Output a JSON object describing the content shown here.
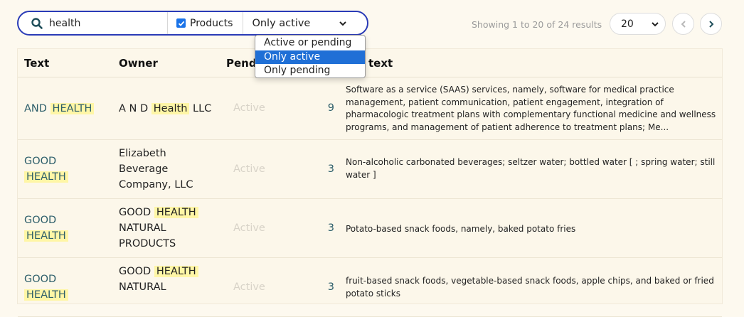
{
  "search": {
    "value": "health",
    "products_label": "Products",
    "products_checked": true,
    "status_selected": "Only active",
    "status_options": [
      "Active or pending",
      "Only active",
      "Only pending"
    ]
  },
  "results_text": "Showing 1 to 20 of 24 results",
  "page_size": "20",
  "table": {
    "headers": [
      "Text",
      "Owner",
      "Pend",
      "text"
    ],
    "rows": [
      {
        "text_pre": "AND",
        "text_hl": "HEALTH",
        "owner_pre": "A N D",
        "owner_hl": "Health",
        "owner_post": "LLC",
        "status": "Active",
        "count": "9",
        "context": "Software as a service (SAAS) services, namely, software for medical practice management, patient communication, patient engagement, integration of pharmacologic treatment plans with complementary functional medicine and wellness programs, and management of patient adherence to treatment plans; Me..."
      },
      {
        "text_pre": "GOOD",
        "text_hl": "HEALTH",
        "owner_full": "Elizabeth Beverage Company, LLC",
        "status": "Active",
        "count": "3",
        "context": "Non-alcoholic carbonated beverages; seltzer water; bottled water [ ; spring water; still water ]"
      },
      {
        "text_pre": "GOOD",
        "text_hl": "HEALTH",
        "owner_pre": "GOOD",
        "owner_hl": "HEALTH",
        "owner_post": "NATURAL PRODUCTS",
        "status": "Active",
        "count": "3",
        "context": "Potato-based snack foods, namely, baked potato fries"
      },
      {
        "text_pre": "GOOD",
        "text_hl": "HEALTH",
        "owner_pre": "GOOD",
        "owner_hl": "HEALTH",
        "owner_post": "NATURAL",
        "status": "Active",
        "count": "3",
        "context": "fruit-based snack foods, vegetable-based snack foods, apple chips, and baked or fried potato sticks"
      }
    ]
  },
  "colors": {
    "accent": "#2a3bb7",
    "highlight": "#fff6a6",
    "link_text": "#2d5e6a",
    "selected_option": "#1f6fd6",
    "background": "#fdf9ef"
  },
  "icons": [
    "search-icon",
    "checkbox-check-icon",
    "chevron-down-icon",
    "chevron-left-icon",
    "chevron-right-icon"
  ]
}
